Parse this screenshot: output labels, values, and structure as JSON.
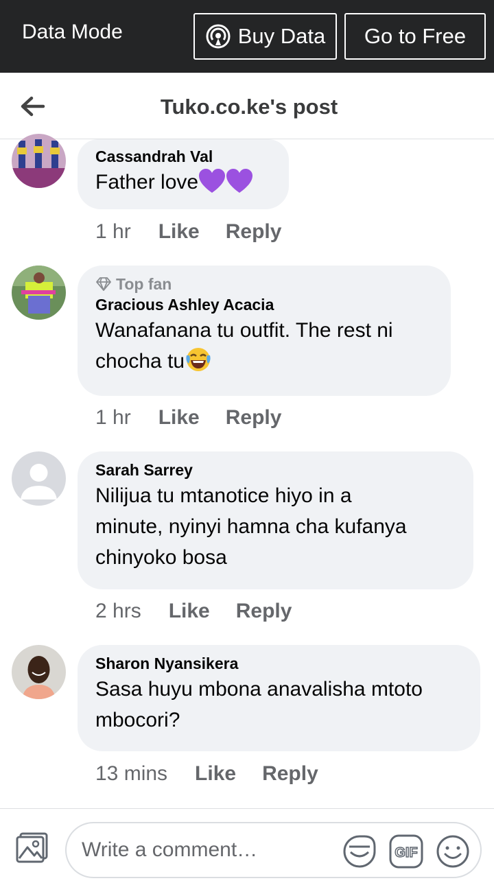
{
  "databar": {
    "mode_label": "Data Mode",
    "buy_label": "Buy Data",
    "free_label": "Go to Free"
  },
  "header": {
    "title": "Tuko.co.ke's post"
  },
  "comments": [
    {
      "name": "Cassandrah Val",
      "text": "Father love",
      "emoji": [
        "purple-heart",
        "purple-heart"
      ],
      "time": "1 hr",
      "like": "Like",
      "reply": "Reply"
    },
    {
      "badge": "Top fan",
      "name": "Gracious Ashley Acacia",
      "text_line1": "Wanafanana tu outfit. The rest ni",
      "text_line2": "chocha tu",
      "emoji": [
        "laughing-crying-face"
      ],
      "time": "1 hr",
      "like": "Like",
      "reply": "Reply"
    },
    {
      "name": "Sarah Sarrey",
      "text_line1": "Nilijua  tu mtanotice hiyo in a",
      "text_line2": "minute,  nyinyi hamna cha kufanya",
      "text_line3": "chinyoko bosa",
      "time": "2 hrs",
      "like": "Like",
      "reply": "Reply"
    },
    {
      "name": "Sharon Nyansikera",
      "text_line1": "Sasa huyu mbona anavalisha mtoto",
      "text_line2": "mbocori?",
      "time": "13 mins",
      "like": "Like",
      "reply": "Reply"
    }
  ],
  "composer": {
    "placeholder": "Write a comment…",
    "gif_label": "GIF"
  },
  "colors": {
    "databar_bg": "#242526",
    "bubble_bg": "#f0f2f5",
    "secondary_text": "#65676b",
    "heart": "#9b51e0"
  }
}
